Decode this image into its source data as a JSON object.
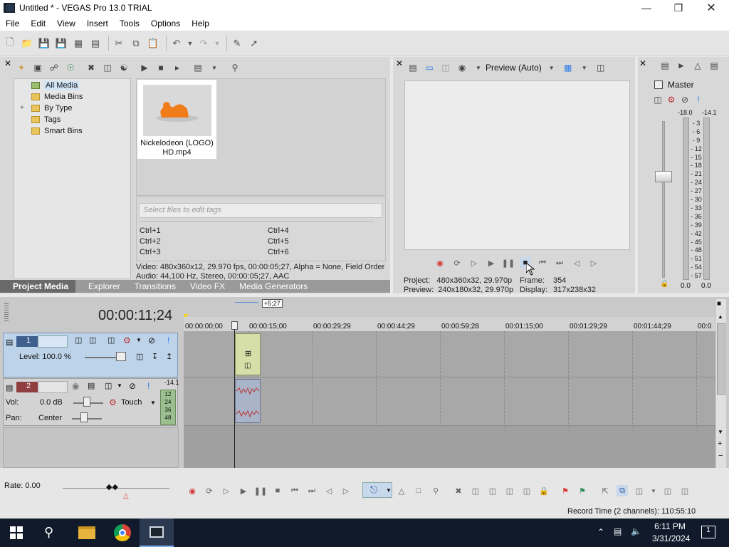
{
  "window": {
    "title": "Untitled * - VEGAS Pro 13.0 TRIAL"
  },
  "menu": [
    "File",
    "Edit",
    "View",
    "Insert",
    "Tools",
    "Options",
    "Help"
  ],
  "explorer": {
    "tree": [
      "All Media",
      "Media Bins",
      "By Type",
      "Tags",
      "Smart Bins"
    ],
    "expand_glyph": "+",
    "media_item": {
      "caption_line1": "Nickelodeon (LOGO)",
      "caption_line2": "HD.mp4"
    },
    "tag_placeholder": "Select files to edit tags",
    "hotkeys": [
      "Ctrl+1",
      "Ctrl+2",
      "Ctrl+3",
      "Ctrl+4",
      "Ctrl+5",
      "Ctrl+6"
    ],
    "info_video": "Video: 480x360x12, 29.970 fps, 00:00:05;27, Alpha = None, Field Order",
    "info_audio": "Audio: 44,100 Hz, Stereo, 00:00:05;27, AAC"
  },
  "tabs": [
    {
      "label": "Project Media",
      "active": true
    },
    {
      "label": "Explorer",
      "active": false
    },
    {
      "label": "Transitions",
      "active": false
    },
    {
      "label": "Video FX",
      "active": false
    },
    {
      "label": "Media Generators",
      "active": false
    }
  ],
  "preview": {
    "mode_label": "Preview (Auto)",
    "project_label": "Project:",
    "project_value": "480x360x32, 29.970p",
    "frame_label": "Frame:",
    "frame_value": "354",
    "preview_label": "Preview:",
    "preview_value": "240x180x32, 29.970p",
    "display_label": "Display:",
    "display_value": "317x238x32"
  },
  "master": {
    "title": "Master",
    "peak_left": "-18.0",
    "peak_right": "-14.1",
    "scale": [
      "3",
      "6",
      "9",
      "12",
      "15",
      "18",
      "21",
      "24",
      "27",
      "30",
      "33",
      "36",
      "39",
      "42",
      "45",
      "48",
      "51",
      "54",
      "57"
    ],
    "bottom_left": "0.0",
    "bottom_right": "0.0"
  },
  "timeline": {
    "timecode": "00:00:11;24",
    "event_length": "+5;27",
    "ruler": [
      "00:00:00;00",
      "00:00:15;00",
      "00:00:29;29",
      "00:00:44;29",
      "00:00:59;28",
      "00:01:15;00",
      "00:01:29;29",
      "00:01:44;29",
      "00:0"
    ],
    "track1": {
      "number": "1",
      "level_label": "Level: 100.0 %"
    },
    "track2": {
      "number": "2",
      "vol_label": "Vol:",
      "vol_value": "0.0 dB",
      "pan_label": "Pan:",
      "pan_value": "Center",
      "automation": "Touch",
      "peak": "-14.1",
      "mini_scale": [
        "12",
        "24",
        "36",
        "48"
      ]
    },
    "rate": "Rate: 0.00"
  },
  "status": {
    "record_time": "Record Time (2 channels): 110:55:10"
  },
  "taskbar": {
    "time": "6:11 PM",
    "date": "3/31/2024",
    "notification_count": "1"
  },
  "colors": {
    "accent": "#2c7be5",
    "track_video": "#3f5f8f",
    "track_audio": "#8f3f3f",
    "event_video": "#d6dfa8"
  }
}
